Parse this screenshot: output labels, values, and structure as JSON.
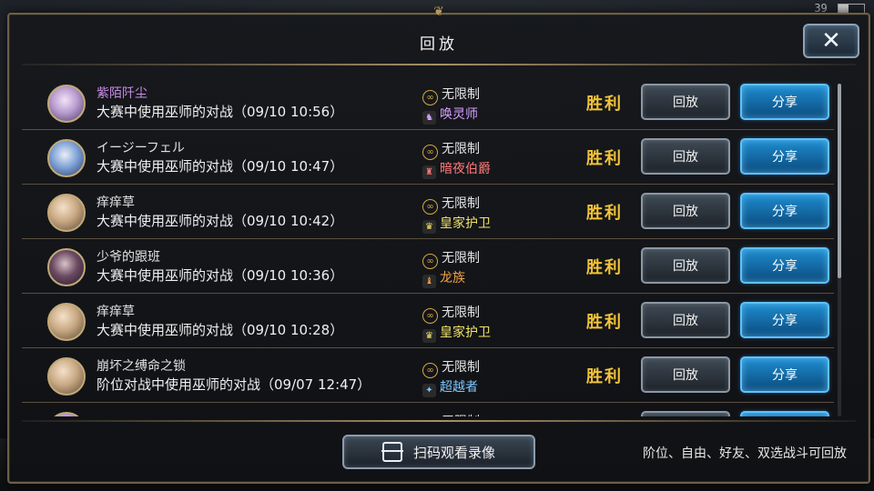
{
  "status": {
    "battery": "39"
  },
  "dialog": {
    "title": "回放",
    "close_icon": "close-icon",
    "scan_label": "扫码观看录像",
    "hint": "阶位、自由、好友、双选战斗可回放"
  },
  "colors": {
    "win": "#f2c33a",
    "share_button": "#1f8ccf",
    "panel_border": "#6d6048",
    "name_highlight": "#c78de6"
  },
  "matches": [
    {
      "name": "紫陌阡尘",
      "highlight": true,
      "avatar": "purple",
      "desc": "大赛中使用巫师的对战（09/10 10:56）",
      "rule": "无限制",
      "class": "唤灵师",
      "class_color": "#d5a0ff",
      "class_icon": "♞",
      "result": "胜利",
      "replay": "回放",
      "share": "分享"
    },
    {
      "name": "イージーフェル",
      "highlight": false,
      "avatar": "blue",
      "desc": "大赛中使用巫师的对战（09/10 10:47）",
      "rule": "无限制",
      "class": "暗夜伯爵",
      "class_color": "#ff7a7a",
      "class_icon": "♜",
      "result": "胜利",
      "replay": "回放",
      "share": "分享"
    },
    {
      "name": "痒痒草",
      "highlight": false,
      "avatar": "",
      "desc": "大赛中使用巫师的对战（09/10 10:42）",
      "rule": "无限制",
      "class": "皇家护卫",
      "class_color": "#f2e36a",
      "class_icon": "♛",
      "result": "胜利",
      "replay": "回放",
      "share": "分享"
    },
    {
      "name": "少爷的跟班",
      "highlight": false,
      "avatar": "dark",
      "desc": "大赛中使用巫师的对战（09/10 10:36）",
      "rule": "无限制",
      "class": "龙族",
      "class_color": "#f0a44c",
      "class_icon": "♝",
      "result": "胜利",
      "replay": "回放",
      "share": "分享"
    },
    {
      "name": "痒痒草",
      "highlight": false,
      "avatar": "",
      "desc": "大赛中使用巫师的对战（09/10 10:28）",
      "rule": "无限制",
      "class": "皇家护卫",
      "class_color": "#f2e36a",
      "class_icon": "♛",
      "result": "胜利",
      "replay": "回放",
      "share": "分享"
    },
    {
      "name": "崩坏之缚命之锁",
      "highlight": false,
      "avatar": "",
      "desc": "阶位对战中使用巫师的对战（09/07 12:47）",
      "rule": "无限制",
      "class": "超越者",
      "class_color": "#7cc8ff",
      "class_icon": "✦",
      "result": "胜利",
      "replay": "回放",
      "share": "分享"
    },
    {
      "name": "",
      "highlight": false,
      "avatar": "purple",
      "desc": "",
      "rule": "无限制",
      "class": "",
      "class_color": "#e4e4e4",
      "class_icon": "",
      "result": "",
      "replay": "",
      "share": ""
    }
  ]
}
